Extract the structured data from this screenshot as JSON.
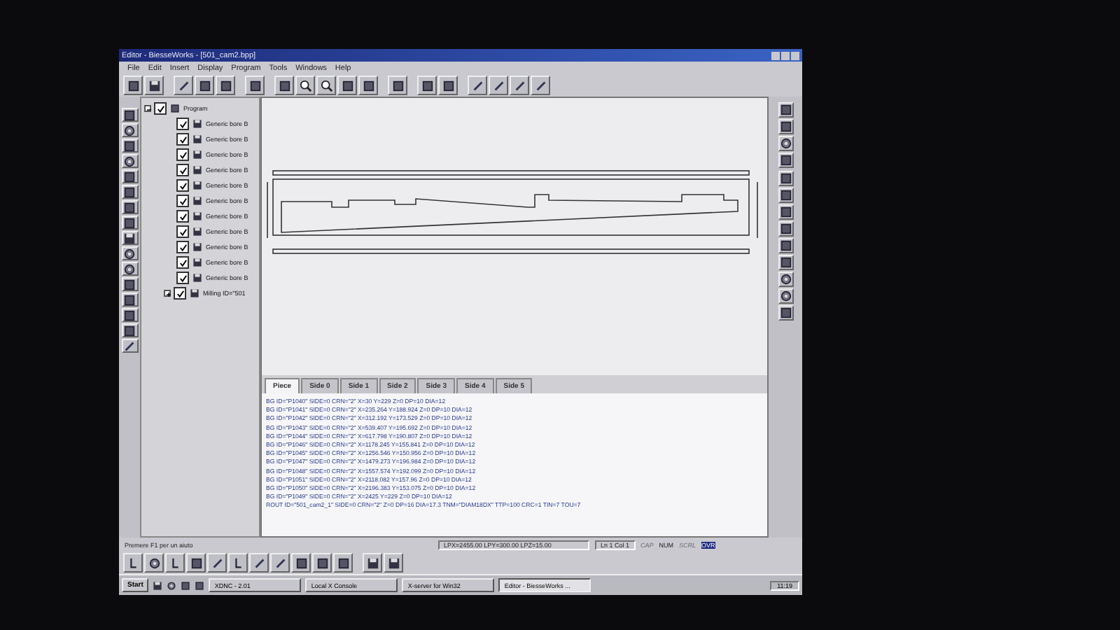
{
  "window": {
    "title": "Editor - BiesseWorks - [501_cam2.bpp]"
  },
  "menu": [
    "File",
    "Edit",
    "Insert",
    "Display",
    "Program",
    "Tools",
    "Windows",
    "Help"
  ],
  "tree": {
    "label": "Program",
    "checked": true,
    "expanded": true,
    "children": [
      {
        "label": "Generic bore B",
        "checked": true
      },
      {
        "label": "Generic bore B",
        "checked": true
      },
      {
        "label": "Generic bore B",
        "checked": true
      },
      {
        "label": "Generic bore B",
        "checked": true
      },
      {
        "label": "Generic bore B",
        "checked": true
      },
      {
        "label": "Generic bore B",
        "checked": true
      },
      {
        "label": "Generic bore B",
        "checked": true
      },
      {
        "label": "Generic bore B",
        "checked": true
      },
      {
        "label": "Generic bore B",
        "checked": true
      },
      {
        "label": "Generic bore B",
        "checked": true
      },
      {
        "label": "Generic bore B",
        "checked": true
      },
      {
        "label": "Milling ID=\"501",
        "checked": true,
        "expandable": true
      }
    ]
  },
  "tabs": [
    {
      "label": "Piece",
      "selected": true
    },
    {
      "label": "Side 0",
      "selected": false
    },
    {
      "label": "Side 1",
      "selected": false
    },
    {
      "label": "Side 2",
      "selected": false
    },
    {
      "label": "Side 3",
      "selected": false
    },
    {
      "label": "Side 4",
      "selected": false
    },
    {
      "label": "Side 5",
      "selected": false
    }
  ],
  "code_lines": [
    "BG ID=\"P1040\" SIDE=0 CRN=\"2\" X=30 Y=229 Z=0 DP=10 DIA=12",
    "BG ID=\"P1041\" SIDE=0 CRN=\"2\" X=235.264 Y=188.924 Z=0 DP=10 DIA=12",
    "BG ID=\"P1042\" SIDE=0 CRN=\"2\" X=312.192 Y=173.529 Z=0 DP=10 DIA=12",
    "BG ID=\"P1043\" SIDE=0 CRN=\"2\" X=539.407 Y=195.692 Z=0 DP=10 DIA=12",
    "BG ID=\"P1044\" SIDE=0 CRN=\"2\" X=617.798 Y=190.807 Z=0 DP=10 DIA=12",
    "BG ID=\"P1046\" SIDE=0 CRN=\"2\" X=1178.245 Y=155.841 Z=0 DP=10 DIA=12",
    "BG ID=\"P1045\" SIDE=0 CRN=\"2\" X=1256.546 Y=150.956 Z=0 DP=10 DIA=12",
    "BG ID=\"P1047\" SIDE=0 CRN=\"2\" X=1479.273 Y=196.984 Z=0 DP=10 DIA=12",
    "BG ID=\"P1048\" SIDE=0 CRN=\"2\" X=1557.574 Y=192.099 Z=0 DP=10 DIA=12",
    "BG ID=\"P1051\" SIDE=0 CRN=\"2\" X=2118.082 Y=157.96 Z=0 DP=10 DIA=12",
    "BG ID=\"P1050\" SIDE=0 CRN=\"2\" X=2196.383 Y=153.075 Z=0 DP=10 DIA=12",
    "BG ID=\"P1049\" SIDE=0 CRN=\"2\" X=2425 Y=229 Z=0 DP=10 DIA=12",
    "ROUT ID=\"501_cam2_1\" SIDE=0 CRN=\"2\" Z=0 DP=16 DIA=17.3 TNM=\"DIAM18DX\" TTP=100 CRC=1 TIN=7 TOU=7"
  ],
  "status_bar": {
    "hint": "Premere F1 per un aiuto",
    "position": "LPX=2455.00 LPY=300.00 LPZ=15.00",
    "cursor": "Ln 1 Col 1",
    "indicators": [
      {
        "label": "CAP",
        "on": false
      },
      {
        "label": "NUM",
        "on": true
      },
      {
        "label": "SCRL",
        "on": false
      },
      {
        "label": "OVR",
        "on": true
      }
    ]
  },
  "taskbar": {
    "start": "Start",
    "tasks": [
      {
        "label": "XDNC - 2.01",
        "selected": false
      },
      {
        "label": "Local X Console",
        "selected": false
      },
      {
        "label": "X-server for Win32",
        "selected": false
      },
      {
        "label": "Editor - BiesseWorks ...",
        "selected": true
      }
    ],
    "clock": "11:19"
  }
}
